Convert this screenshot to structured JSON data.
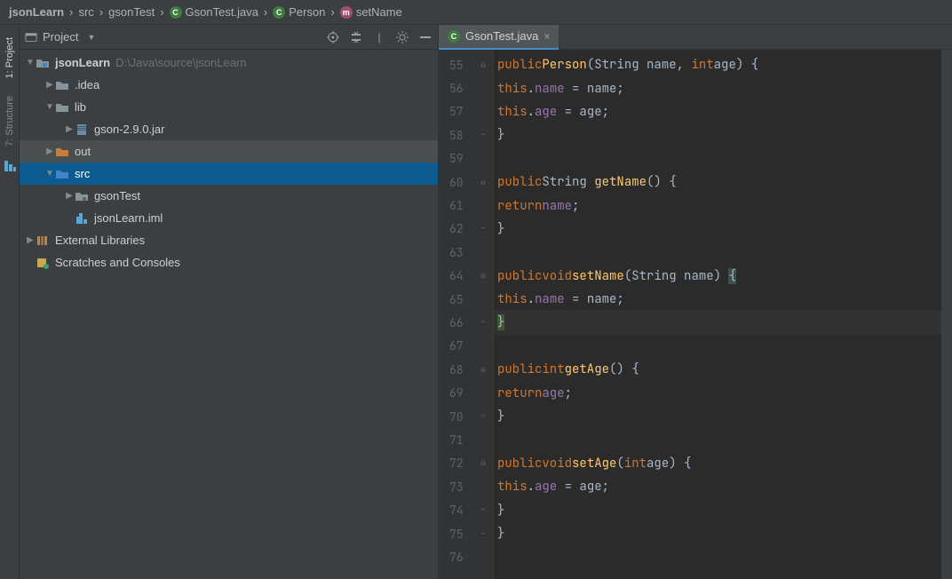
{
  "breadcrumb": {
    "project": "jsonLearn",
    "parts": [
      "src",
      "gsonTest"
    ],
    "class": "GsonTest.java",
    "innerClass": "Person",
    "method": "setName"
  },
  "sidebar": {
    "tabs": {
      "project": "1: Project",
      "structure": "7: Structure"
    }
  },
  "projectPanel": {
    "title": "Project",
    "tree": {
      "rootName": "jsonLearn",
      "rootPath": "D:\\Java\\source\\jsonLearn",
      "idea": ".idea",
      "lib": "lib",
      "gsonJar": "gson-2.9.0.jar",
      "out": "out",
      "src": "src",
      "gsonTest": "gsonTest",
      "iml": "jsonLearn.iml",
      "extLibs": "External Libraries",
      "scratches": "Scratches and Consoles"
    }
  },
  "editor": {
    "tab": {
      "name": "GsonTest.java"
    },
    "startLine": 55,
    "lines": [
      {
        "n": 55,
        "mark": "fold",
        "tokens": [
          [
            "sp",
            "        "
          ],
          [
            "kw",
            "public"
          ],
          [
            "sp",
            " "
          ],
          [
            "fn",
            "Person"
          ],
          [
            "pun",
            "("
          ],
          [
            "type",
            "String "
          ],
          [
            "pun",
            "name"
          ],
          [
            "pun",
            ", "
          ],
          [
            "kw",
            "int"
          ],
          [
            "sp",
            " "
          ],
          [
            "pun",
            "age"
          ],
          [
            "pun",
            ") {"
          ]
        ]
      },
      {
        "n": 56,
        "mark": "",
        "tokens": [
          [
            "sp",
            "            "
          ],
          [
            "kw",
            "this"
          ],
          [
            "pun",
            "."
          ],
          [
            "fld",
            "name"
          ],
          [
            "pun",
            " = name;"
          ]
        ]
      },
      {
        "n": 57,
        "mark": "",
        "tokens": [
          [
            "sp",
            "            "
          ],
          [
            "kw",
            "this"
          ],
          [
            "pun",
            "."
          ],
          [
            "fld",
            "age"
          ],
          [
            "pun",
            " = age;"
          ]
        ]
      },
      {
        "n": 58,
        "mark": "close",
        "tokens": [
          [
            "sp",
            "        "
          ],
          [
            "pun",
            "}"
          ]
        ]
      },
      {
        "n": 59,
        "mark": "",
        "tokens": []
      },
      {
        "n": 60,
        "mark": "fold",
        "tokens": [
          [
            "sp",
            "        "
          ],
          [
            "kw",
            "public"
          ],
          [
            "sp",
            " "
          ],
          [
            "type",
            "String "
          ],
          [
            "fn",
            "getName"
          ],
          [
            "pun",
            "() {"
          ]
        ]
      },
      {
        "n": 61,
        "mark": "",
        "tokens": [
          [
            "sp",
            "            "
          ],
          [
            "kw",
            "return"
          ],
          [
            "sp",
            " "
          ],
          [
            "fld",
            "name"
          ],
          [
            "pun",
            ";"
          ]
        ]
      },
      {
        "n": 62,
        "mark": "close",
        "tokens": [
          [
            "sp",
            "        "
          ],
          [
            "pun",
            "}"
          ]
        ]
      },
      {
        "n": 63,
        "mark": "",
        "tokens": []
      },
      {
        "n": 64,
        "mark": "fold",
        "hl": false,
        "tokens": [
          [
            "sp",
            "        "
          ],
          [
            "kw",
            "public"
          ],
          [
            "sp",
            " "
          ],
          [
            "kw",
            "void"
          ],
          [
            "sp",
            " "
          ],
          [
            "fn",
            "setName"
          ],
          [
            "pun",
            "("
          ],
          [
            "type",
            "String "
          ],
          [
            "pun",
            "name"
          ],
          [
            "pun",
            ") "
          ],
          [
            "brace",
            "{"
          ]
        ]
      },
      {
        "n": 65,
        "mark": "",
        "tokens": [
          [
            "sp",
            "            "
          ],
          [
            "kw",
            "this"
          ],
          [
            "pun",
            "."
          ],
          [
            "fld",
            "name"
          ],
          [
            "pun",
            " = name;"
          ]
        ]
      },
      {
        "n": 66,
        "mark": "close",
        "hl": true,
        "tokens": [
          [
            "sp",
            "        "
          ],
          [
            "caret",
            "}"
          ]
        ]
      },
      {
        "n": 67,
        "mark": "",
        "tokens": []
      },
      {
        "n": 68,
        "mark": "fold",
        "tokens": [
          [
            "sp",
            "        "
          ],
          [
            "kw",
            "public"
          ],
          [
            "sp",
            " "
          ],
          [
            "kw",
            "int"
          ],
          [
            "sp",
            " "
          ],
          [
            "fn",
            "getAge"
          ],
          [
            "pun",
            "() {"
          ]
        ]
      },
      {
        "n": 69,
        "mark": "",
        "tokens": [
          [
            "sp",
            "            "
          ],
          [
            "kw",
            "return"
          ],
          [
            "sp",
            " "
          ],
          [
            "fld",
            "age"
          ],
          [
            "pun",
            ";"
          ]
        ]
      },
      {
        "n": 70,
        "mark": "close",
        "tokens": [
          [
            "sp",
            "        "
          ],
          [
            "pun",
            "}"
          ]
        ]
      },
      {
        "n": 71,
        "mark": "",
        "tokens": []
      },
      {
        "n": 72,
        "mark": "fold",
        "tokens": [
          [
            "sp",
            "        "
          ],
          [
            "kw",
            "public"
          ],
          [
            "sp",
            " "
          ],
          [
            "kw",
            "void"
          ],
          [
            "sp",
            " "
          ],
          [
            "fn",
            "setAge"
          ],
          [
            "pun",
            "("
          ],
          [
            "kw",
            "int"
          ],
          [
            "sp",
            " "
          ],
          [
            "pun",
            "age"
          ],
          [
            "pun",
            ") {"
          ]
        ]
      },
      {
        "n": 73,
        "mark": "",
        "tokens": [
          [
            "sp",
            "            "
          ],
          [
            "kw",
            "this"
          ],
          [
            "pun",
            "."
          ],
          [
            "fld",
            "age"
          ],
          [
            "pun",
            " = age;"
          ]
        ]
      },
      {
        "n": 74,
        "mark": "close",
        "tokens": [
          [
            "sp",
            "        "
          ],
          [
            "pun",
            "}"
          ]
        ]
      },
      {
        "n": 75,
        "mark": "close",
        "tokens": [
          [
            "sp",
            "    "
          ],
          [
            "pun",
            "}"
          ]
        ]
      },
      {
        "n": 76,
        "mark": "",
        "tokens": []
      }
    ]
  }
}
